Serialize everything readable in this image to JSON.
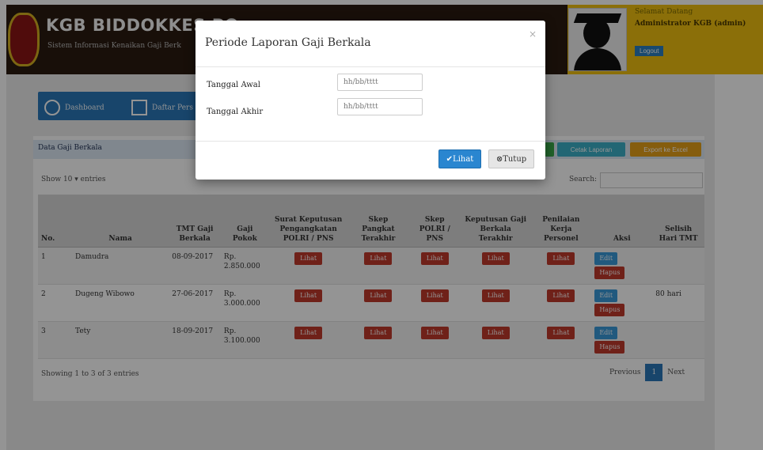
{
  "header": {
    "title": "KGB BIDDOKKES PO",
    "subtitle": "Sistem Informasi Kenaikan Gaji Berk",
    "user_greeting": "Selamat Datang",
    "user_role": "Administrator KGB (admin)",
    "logout_label": "Logout"
  },
  "nav": {
    "dashboard_label": "Dashboard",
    "daftar_label": "Daftar Pers"
  },
  "card": {
    "title": "Data Gaji Berkala",
    "btn_cetak": "Cetak Laporan",
    "btn_export": "Export ke Excel",
    "show_entries": "Show  10  ▾ entries",
    "search_label": "Search:"
  },
  "table": {
    "headers": [
      "No.",
      "Nama",
      "TMT Gaji Berkala",
      "Gaji Pokok",
      "Surat Keputusan Pengangkatan POLRI / PNS",
      "Skep Pangkat Terakhir",
      "Skep POLRI / PNS",
      "Keputusan Gaji Berkala Terakhir",
      "Penilaian Kerja Personel",
      "Aksi",
      "Selisih Hari TMT"
    ],
    "rows": [
      {
        "no": "1",
        "nama": "Damudra",
        "tmt": "08-09-2017",
        "gaji": "Rp. 2.850.000",
        "selisih": ""
      },
      {
        "no": "2",
        "nama": "Dugeng Wibowo",
        "tmt": "27-06-2017",
        "gaji": "Rp. 3.000.000",
        "selisih": "80 hari"
      },
      {
        "no": "3",
        "nama": "Tety",
        "tmt": "18-09-2017",
        "gaji": "Rp. 3.100.000",
        "selisih": ""
      }
    ],
    "lihat_label": "Lihat",
    "edit_label": "Edit",
    "hapus_label": "Hapus"
  },
  "footer": {
    "info": "Showing 1 to 3 of 3 entries",
    "prev": "Previous",
    "page": "1",
    "next": "Next"
  },
  "modal": {
    "title": "Periode Laporan Gaji Berkala",
    "close": "×",
    "start_label": "Tanggal Awal",
    "start_placeholder": "hh/bb/tttt",
    "end_label": "Tanggal Akhir",
    "end_placeholder": "hh/bb/tttt",
    "btn_view": "✔Lihat",
    "btn_close": "⊗Tutup"
  },
  "colors": {
    "topbar": "#2a1a10",
    "user_box": "#f0c010",
    "primary": "#2a86d0",
    "danger": "#c0392b"
  }
}
